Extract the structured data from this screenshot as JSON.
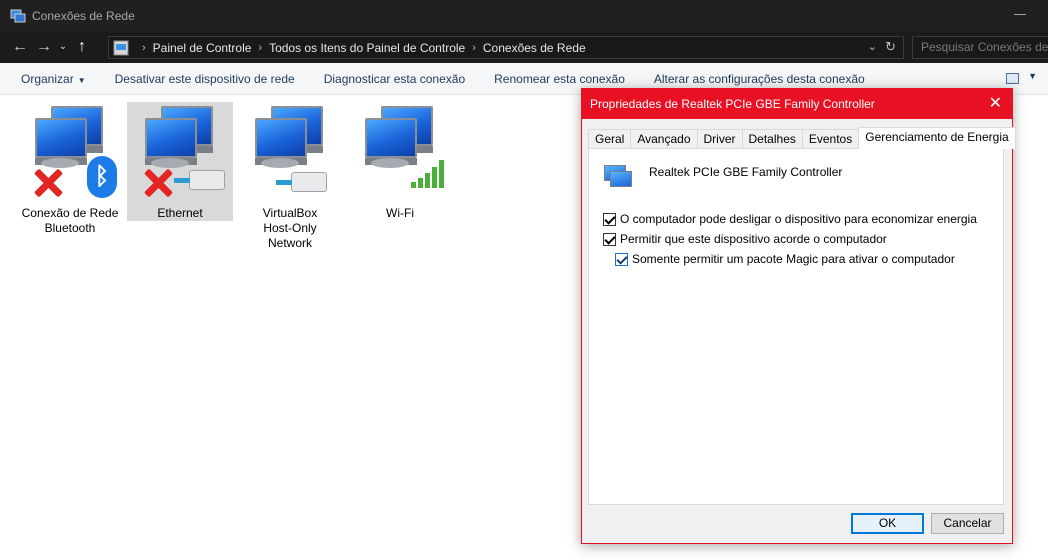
{
  "window": {
    "title": "Conexões de Rede"
  },
  "address": {
    "crumbs": [
      "Painel de Controle",
      "Todos os Itens do Painel de Controle",
      "Conexões de Rede"
    ],
    "search_placeholder": "Pesquisar Conexões de Rede"
  },
  "commands": {
    "organize": "Organizar",
    "disable": "Desativar este dispositivo de rede",
    "diagnose": "Diagnosticar esta conexão",
    "rename": "Renomear esta conexão",
    "change_settings": "Alterar as configurações desta conexão"
  },
  "connections": [
    {
      "line1": "Conexão de Rede",
      "line2": "Bluetooth",
      "line3": ""
    },
    {
      "line1": "Ethernet",
      "line2": "",
      "line3": ""
    },
    {
      "line1": "VirtualBox",
      "line2": "Host-Only",
      "line3": "Network"
    },
    {
      "line1": "Wi-Fi",
      "line2": "",
      "line3": ""
    }
  ],
  "dialog": {
    "title": "Propriedades de Realtek PCIe GBE Family Controller",
    "tabs": [
      "Geral",
      "Avançado",
      "Driver",
      "Detalhes",
      "Eventos",
      "Gerenciamento de Energia"
    ],
    "device_name": "Realtek PCIe GBE Family Controller",
    "options": [
      {
        "label": "O computador pode desligar o dispositivo para economizar energia",
        "checked": true
      },
      {
        "label": "Permitir que este dispositivo acorde o computador",
        "checked": true
      },
      {
        "label": "Somente permitir um pacote Magic para ativar o computador",
        "checked": true
      }
    ],
    "ok_label": "OK",
    "cancel_label": "Cancelar"
  },
  "colors": {
    "accent": "#e81123",
    "dark_chrome": "#202020"
  }
}
